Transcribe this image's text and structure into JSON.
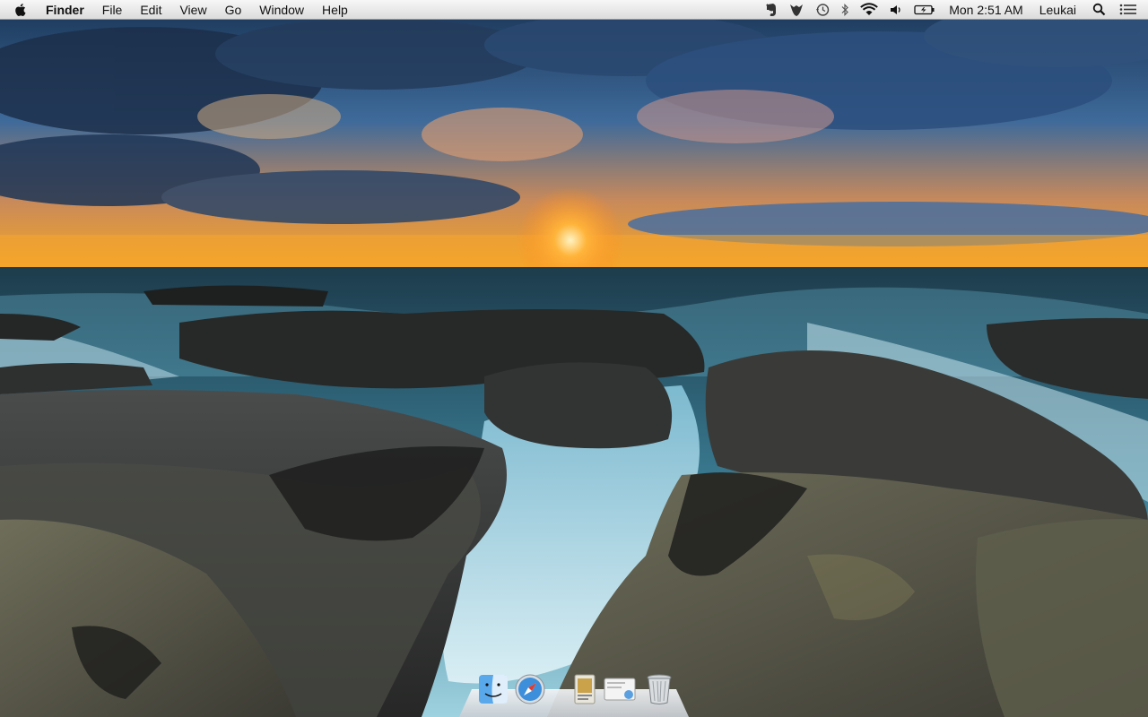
{
  "menubar": {
    "apple_icon": "apple-icon",
    "app_name": "Finder",
    "menus": [
      "File",
      "Edit",
      "View",
      "Go",
      "Window",
      "Help"
    ],
    "status_icons": [
      "evernote-icon",
      "growl-icon",
      "time-machine-icon",
      "bluetooth-icon",
      "wifi-icon",
      "volume-icon",
      "battery-icon"
    ],
    "clock": "Mon 2:51 AM",
    "user": "Leukai",
    "search_icon": "spotlight-icon",
    "notification_icon": "notification-center-icon"
  },
  "dock": {
    "items": [
      {
        "name": "Finder",
        "icon": "finder-icon"
      },
      {
        "name": "Safari",
        "icon": "safari-icon"
      },
      {
        "name": "Documents",
        "icon": "documents-stack-icon"
      },
      {
        "name": "Downloads",
        "icon": "downloads-stack-icon"
      },
      {
        "name": "Trash",
        "icon": "trash-icon"
      }
    ]
  },
  "colors": {
    "sky_top": "#1f3a5c",
    "sunset": "#f7a31c",
    "ocean": "#2f6b84",
    "rock": "#3a3a38"
  }
}
